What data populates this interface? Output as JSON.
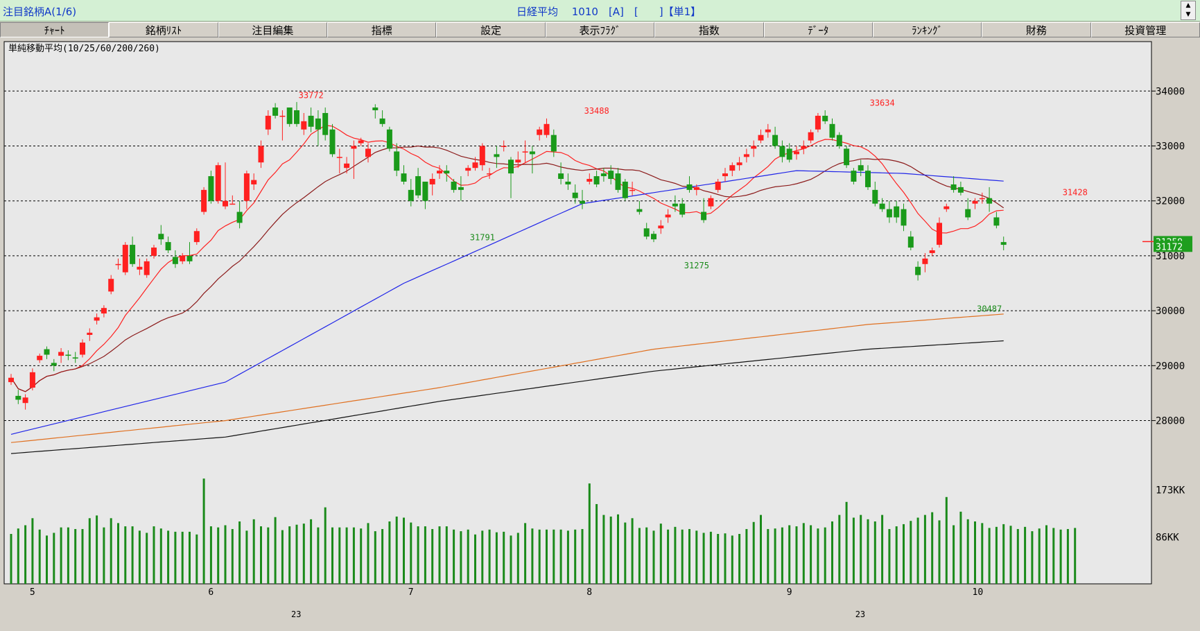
{
  "window": {
    "title_left": "注目銘柄A(1/6)",
    "title_center": "日経平均　 1010　[A]　[　　]【単1】"
  },
  "tabs": [
    {
      "label": "ﾁｬｰﾄ",
      "active": true
    },
    {
      "label": "銘柄ﾘｽﾄ"
    },
    {
      "label": "注目編集"
    },
    {
      "label": "指標"
    },
    {
      "label": "設定"
    },
    {
      "label": "表示ﾌﾗｸﾞ"
    },
    {
      "label": "指数"
    },
    {
      "label": "ﾃﾞｰﾀ"
    },
    {
      "label": "ﾗﾝｷﾝｸﾞ"
    },
    {
      "label": "財務"
    },
    {
      "label": "投資管理"
    }
  ],
  "chart_data": {
    "type": "candlestick",
    "indicator_label": "単純移動平均(10/25/60/200/260)",
    "price_axis": {
      "ylim": [
        27300,
        34900
      ],
      "ticks": [
        28000,
        29000,
        30000,
        31000,
        32000,
        33000,
        34000
      ]
    },
    "volume_axis": {
      "ylim": [
        0,
        230000
      ],
      "tick_labels": [
        "173KK",
        "86KK"
      ],
      "tick_values": [
        173000,
        86000
      ]
    },
    "x_month_labels": [
      {
        "label": "5",
        "index": 3
      },
      {
        "label": "6",
        "index": 28
      },
      {
        "label": "7",
        "index": 56
      },
      {
        "label": "8",
        "index": 81
      },
      {
        "label": "9",
        "index": 109
      },
      {
        "label": "10",
        "index": 135
      }
    ],
    "x_day_labels": [
      {
        "label": "23",
        "index": 40
      },
      {
        "label": "23",
        "index": 119
      }
    ],
    "peak_labels": [
      {
        "text": "33772",
        "index": 42,
        "value": 33772,
        "kind": "high"
      },
      {
        "text": "33488",
        "index": 82,
        "value": 33488,
        "kind": "high"
      },
      {
        "text": "33634",
        "index": 122,
        "value": 33634,
        "kind": "high"
      },
      {
        "text": "31428",
        "index": 149,
        "value": 32000,
        "kind": "high"
      },
      {
        "text": "31791",
        "index": 66,
        "value": 31791,
        "kind": "low"
      },
      {
        "text": "31275",
        "index": 96,
        "value": 31275,
        "kind": "low"
      },
      {
        "text": "30487",
        "index": 137,
        "value": 30487,
        "kind": "low"
      }
    ],
    "current_price_labels": [
      {
        "text": "31259",
        "value": 31259,
        "bg": "#1e9e1e"
      },
      {
        "text": "31172",
        "value": 31172,
        "bg": "#1e9e1e"
      }
    ],
    "ohlc": [
      [
        28700,
        28850,
        28650,
        28780
      ],
      [
        28450,
        28560,
        28300,
        28380
      ],
      [
        28320,
        28480,
        28200,
        28420
      ],
      [
        28600,
        28950,
        28550,
        28880
      ],
      [
        29100,
        29220,
        29050,
        29180
      ],
      [
        29300,
        29350,
        29120,
        29200
      ],
      [
        29050,
        29120,
        28900,
        29000
      ],
      [
        29180,
        29320,
        29050,
        29250
      ],
      [
        29200,
        29280,
        29100,
        29180
      ],
      [
        29150,
        29250,
        29050,
        29130
      ],
      [
        29200,
        29480,
        29150,
        29420
      ],
      [
        29560,
        29680,
        29450,
        29600
      ],
      [
        29820,
        29950,
        29750,
        29880
      ],
      [
        29950,
        30100,
        29880,
        30050
      ],
      [
        30350,
        30650,
        30300,
        30580
      ],
      [
        30850,
        30950,
        30750,
        30850
      ],
      [
        30700,
        31250,
        30650,
        31200
      ],
      [
        31200,
        31350,
        30800,
        30850
      ],
      [
        30750,
        30950,
        30650,
        30800
      ],
      [
        30650,
        30950,
        30600,
        30900
      ],
      [
        31000,
        31200,
        30950,
        31150
      ],
      [
        31400,
        31560,
        31200,
        31300
      ],
      [
        31250,
        31350,
        31050,
        31100
      ],
      [
        30980,
        31100,
        30780,
        30850
      ],
      [
        30900,
        31050,
        30850,
        31000
      ],
      [
        31000,
        31250,
        30850,
        30900
      ],
      [
        31250,
        31500,
        31200,
        31450
      ],
      [
        31800,
        32250,
        31750,
        32200
      ],
      [
        32450,
        32550,
        31950,
        32000
      ],
      [
        32000,
        32700,
        31950,
        32650
      ],
      [
        31900,
        32700,
        31850,
        32000
      ],
      [
        31950,
        32100,
        31950,
        31950
      ],
      [
        31800,
        32000,
        31500,
        31600
      ],
      [
        32000,
        32550,
        31850,
        32500
      ],
      [
        32300,
        32500,
        32200,
        32380
      ],
      [
        32700,
        33100,
        32600,
        33000
      ],
      [
        33300,
        33650,
        33200,
        33550
      ],
      [
        33700,
        33780,
        33500,
        33550
      ],
      [
        33550,
        33650,
        33100,
        33550
      ],
      [
        33700,
        33600,
        33350,
        33400
      ],
      [
        33650,
        33800,
        33350,
        33400
      ],
      [
        33300,
        33600,
        33200,
        33450
      ],
      [
        33550,
        33700,
        33250,
        33350
      ],
      [
        33500,
        33650,
        33000,
        33300
      ],
      [
        33600,
        33700,
        33100,
        33200
      ],
      [
        33300,
        33400,
        32800,
        32850
      ],
      [
        32800,
        32950,
        32500,
        32800
      ],
      [
        32600,
        32800,
        32500,
        32680
      ],
      [
        32950,
        33100,
        32400,
        33000
      ],
      [
        33050,
        33150,
        33000,
        33100
      ],
      [
        32800,
        33050,
        32700,
        32950
      ],
      [
        33700,
        33760,
        33500,
        33650
      ],
      [
        33500,
        33650,
        33350,
        33400
      ],
      [
        33300,
        33350,
        32900,
        32950
      ],
      [
        32900,
        33050,
        32450,
        32550
      ],
      [
        32500,
        32650,
        32300,
        32350
      ],
      [
        32200,
        32400,
        31900,
        32000
      ],
      [
        32450,
        32600,
        32050,
        32100
      ],
      [
        32350,
        32350,
        31850,
        32000
      ],
      [
        32300,
        32500,
        32100,
        32400
      ],
      [
        32500,
        32650,
        32400,
        32550
      ],
      [
        32550,
        32650,
        32350,
        32500
      ],
      [
        32350,
        32400,
        32150,
        32200
      ],
      [
        32250,
        32450,
        32000,
        32200
      ],
      [
        32550,
        32650,
        32450,
        32600
      ],
      [
        32600,
        32800,
        32550,
        32700
      ],
      [
        32650,
        33050,
        32550,
        33000
      ],
      [
        32500,
        32600,
        32400,
        32500
      ],
      [
        32850,
        33000,
        32600,
        32800
      ],
      [
        33000,
        33100,
        32900,
        33000
      ],
      [
        32750,
        32800,
        32050,
        32500
      ],
      [
        32700,
        32900,
        32600,
        32750
      ],
      [
        32900,
        33100,
        32700,
        32900
      ],
      [
        32900,
        33000,
        32500,
        32850
      ],
      [
        33200,
        33350,
        33100,
        33300
      ],
      [
        33200,
        33500,
        33150,
        33400
      ],
      [
        33200,
        33300,
        32800,
        32900
      ],
      [
        32500,
        32700,
        32300,
        32400
      ],
      [
        32350,
        32500,
        32200,
        32300
      ],
      [
        32150,
        32300,
        31950,
        32050
      ],
      [
        32000,
        32200,
        31850,
        31950
      ],
      [
        32350,
        32500,
        32300,
        32400
      ],
      [
        32450,
        32550,
        32250,
        32300
      ],
      [
        32500,
        32600,
        32350,
        32450
      ],
      [
        32550,
        32650,
        32300,
        32400
      ],
      [
        32500,
        32600,
        32150,
        32200
      ],
      [
        32350,
        32400,
        32000,
        32050
      ],
      [
        32200,
        32350,
        32100,
        32200
      ],
      [
        31850,
        32000,
        31750,
        31800
      ],
      [
        31500,
        31600,
        31300,
        31350
      ],
      [
        31400,
        31450,
        31250,
        31300
      ],
      [
        31500,
        31650,
        31400,
        31550
      ],
      [
        31700,
        31850,
        31600,
        31750
      ],
      [
        31950,
        32100,
        31800,
        31900
      ],
      [
        31950,
        32050,
        31700,
        31750
      ],
      [
        32300,
        32450,
        32150,
        32200
      ],
      [
        32200,
        32300,
        32100,
        32250
      ],
      [
        31800,
        32050,
        31600,
        31650
      ],
      [
        31900,
        32100,
        31850,
        32050
      ],
      [
        32200,
        32400,
        32150,
        32350
      ],
      [
        32450,
        32600,
        32350,
        32500
      ],
      [
        32550,
        32700,
        32450,
        32650
      ],
      [
        32650,
        32800,
        32550,
        32700
      ],
      [
        32800,
        32950,
        32700,
        32850
      ],
      [
        32950,
        33100,
        32800,
        33000
      ],
      [
        33100,
        33300,
        33050,
        33200
      ],
      [
        33250,
        33400,
        33150,
        33300
      ],
      [
        33200,
        33350,
        32950,
        33000
      ],
      [
        33000,
        33100,
        32700,
        32800
      ],
      [
        32950,
        33050,
        32700,
        32750
      ],
      [
        32850,
        33000,
        32750,
        32900
      ],
      [
        32950,
        33100,
        32850,
        33000
      ],
      [
        33100,
        33300,
        33050,
        33250
      ],
      [
        33300,
        33600,
        33250,
        33550
      ],
      [
        33550,
        33650,
        33400,
        33450
      ],
      [
        33400,
        33500,
        33100,
        33150
      ],
      [
        33200,
        33250,
        32950,
        33000
      ],
      [
        32950,
        33000,
        32600,
        32650
      ],
      [
        32550,
        32600,
        32300,
        32350
      ],
      [
        32650,
        32750,
        32450,
        32550
      ],
      [
        32550,
        32650,
        32200,
        32250
      ],
      [
        32200,
        32350,
        31900,
        31950
      ],
      [
        31950,
        32050,
        31800,
        31850
      ],
      [
        31850,
        32000,
        31600,
        31700
      ],
      [
        31900,
        32000,
        31600,
        31700
      ],
      [
        31850,
        31950,
        31450,
        31550
      ],
      [
        31350,
        31450,
        31100,
        31150
      ],
      [
        30800,
        30900,
        30550,
        30650
      ],
      [
        30850,
        31050,
        30700,
        30950
      ],
      [
        31050,
        31150,
        31000,
        31100
      ],
      [
        31200,
        31700,
        31150,
        31600
      ],
      [
        31850,
        31950,
        31800,
        31900
      ],
      [
        32300,
        32450,
        32150,
        32200
      ],
      [
        32250,
        32350,
        32100,
        32150
      ],
      [
        31850,
        32050,
        31650,
        31700
      ],
      [
        31950,
        32050,
        31850,
        32000
      ],
      [
        32050,
        32150,
        31950,
        32050
      ],
      [
        32050,
        32250,
        31800,
        31950
      ],
      [
        31700,
        31800,
        31500,
        31550
      ],
      [
        31250,
        31350,
        31100,
        31200
      ]
    ],
    "volume": [
      92000,
      102000,
      108000,
      121000,
      100000,
      89000,
      94000,
      104000,
      104000,
      101000,
      101000,
      121000,
      126000,
      104000,
      121000,
      112000,
      106000,
      106000,
      98000,
      94000,
      106000,
      102000,
      98000,
      96000,
      96000,
      96000,
      91000,
      194000,
      106000,
      104000,
      108000,
      101000,
      115000,
      98000,
      119000,
      106000,
      104000,
      123000,
      99000,
      106000,
      109000,
      111000,
      119000,
      104000,
      141000,
      104000,
      104000,
      104000,
      104000,
      102000,
      112000,
      97000,
      101000,
      115000,
      124000,
      122000,
      113000,
      106000,
      106000,
      101000,
      106000,
      106000,
      100000,
      97000,
      100000,
      91000,
      98000,
      100000,
      95000,
      96000,
      89000,
      94000,
      112000,
      102000,
      100000,
      100000,
      100000,
      100000,
      98000,
      100000,
      101000,
      185000,
      147000,
      127000,
      124000,
      128000,
      113000,
      121000,
      103000,
      104000,
      98000,
      111000,
      100000,
      105000,
      100000,
      101000,
      98000,
      94000,
      96000,
      92000,
      93000,
      89000,
      92000,
      101000,
      114000,
      127000,
      101000,
      102000,
      104000,
      108000,
      106000,
      112000,
      108000,
      102000,
      104000,
      115000,
      127000,
      151000,
      122000,
      127000,
      119000,
      115000,
      127000,
      101000,
      106000,
      110000,
      116000,
      122000,
      127000,
      132000,
      117000,
      160000,
      108000,
      133000,
      119000,
      115000,
      112000,
      103000,
      105000,
      110000,
      107000,
      101000,
      105000,
      97000,
      102000,
      108000,
      103000,
      100000,
      101000,
      103000
    ],
    "moving_averages": [
      {
        "period": 10,
        "color": "#ff2020"
      },
      {
        "period": 25,
        "color": "#8b1a1a"
      },
      {
        "period": 60,
        "color": "#1f24e8"
      },
      {
        "period": 200,
        "color": "#e07020"
      },
      {
        "period": 260,
        "color": "#111111"
      }
    ],
    "ma_long_anchors": {
      "ma60": [
        [
          0,
          27750
        ],
        [
          30,
          28700
        ],
        [
          55,
          30500
        ],
        [
          80,
          31950
        ],
        [
          110,
          32550
        ],
        [
          125,
          32500
        ],
        [
          150,
          32250
        ]
      ],
      "ma200": [
        [
          0,
          27600
        ],
        [
          30,
          28000
        ],
        [
          60,
          28600
        ],
        [
          90,
          29300
        ],
        [
          120,
          29750
        ],
        [
          145,
          30000
        ],
        [
          150,
          30150
        ]
      ],
      "ma260": [
        [
          0,
          27400
        ],
        [
          30,
          27700
        ],
        [
          60,
          28350
        ],
        [
          90,
          28900
        ],
        [
          120,
          29300
        ],
        [
          145,
          29500
        ],
        [
          150,
          29550
        ]
      ]
    },
    "colors": {
      "up": "#ff2020",
      "down": "#1a9a1a",
      "volume": "#1a8a1a",
      "plot_bg": "#e8e8e8",
      "peak_high": "#ff2020",
      "peak_low": "#1a8a1a"
    }
  }
}
